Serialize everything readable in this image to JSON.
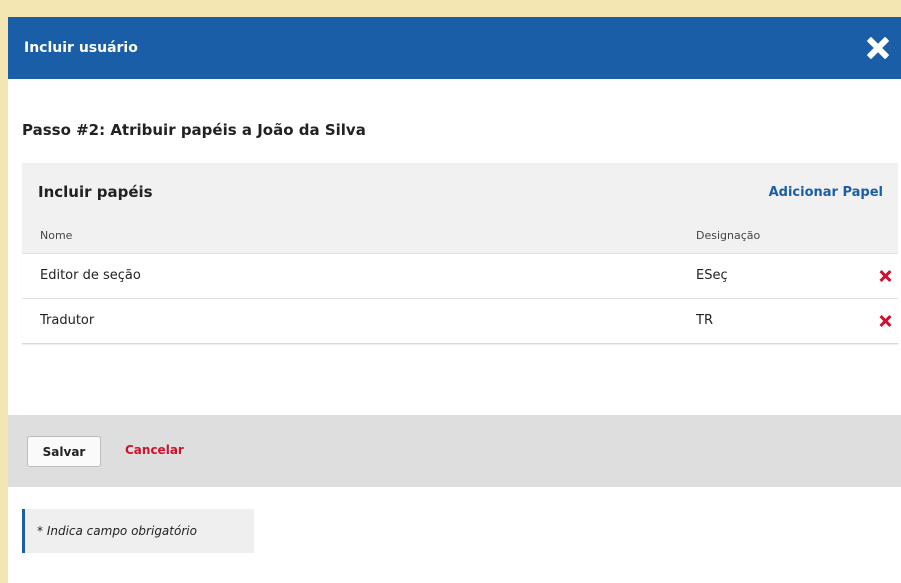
{
  "modal": {
    "title": "Incluir usuário",
    "close_icon": "close-icon"
  },
  "step": {
    "title": "Passo #2: Atribuir papéis a João da Silva"
  },
  "roles_panel": {
    "title": "Incluir papéis",
    "add_link": "Adicionar Papel",
    "columns": [
      "Nome",
      "Designação"
    ],
    "rows": [
      {
        "name": "Editor de seção",
        "abbr": "ESeç",
        "delete_icon": "delete-icon"
      },
      {
        "name": "Tradutor",
        "abbr": "TR",
        "delete_icon": "delete-icon"
      }
    ]
  },
  "footer": {
    "save_label": "Salvar",
    "cancel_label": "Cancelar"
  },
  "note": {
    "text": "* Indica campo obrigatório"
  },
  "colors": {
    "header_bg": "#1a5ea8",
    "page_bg": "#f4e6b3",
    "danger": "#d0112b",
    "link": "#1a5ea8"
  }
}
